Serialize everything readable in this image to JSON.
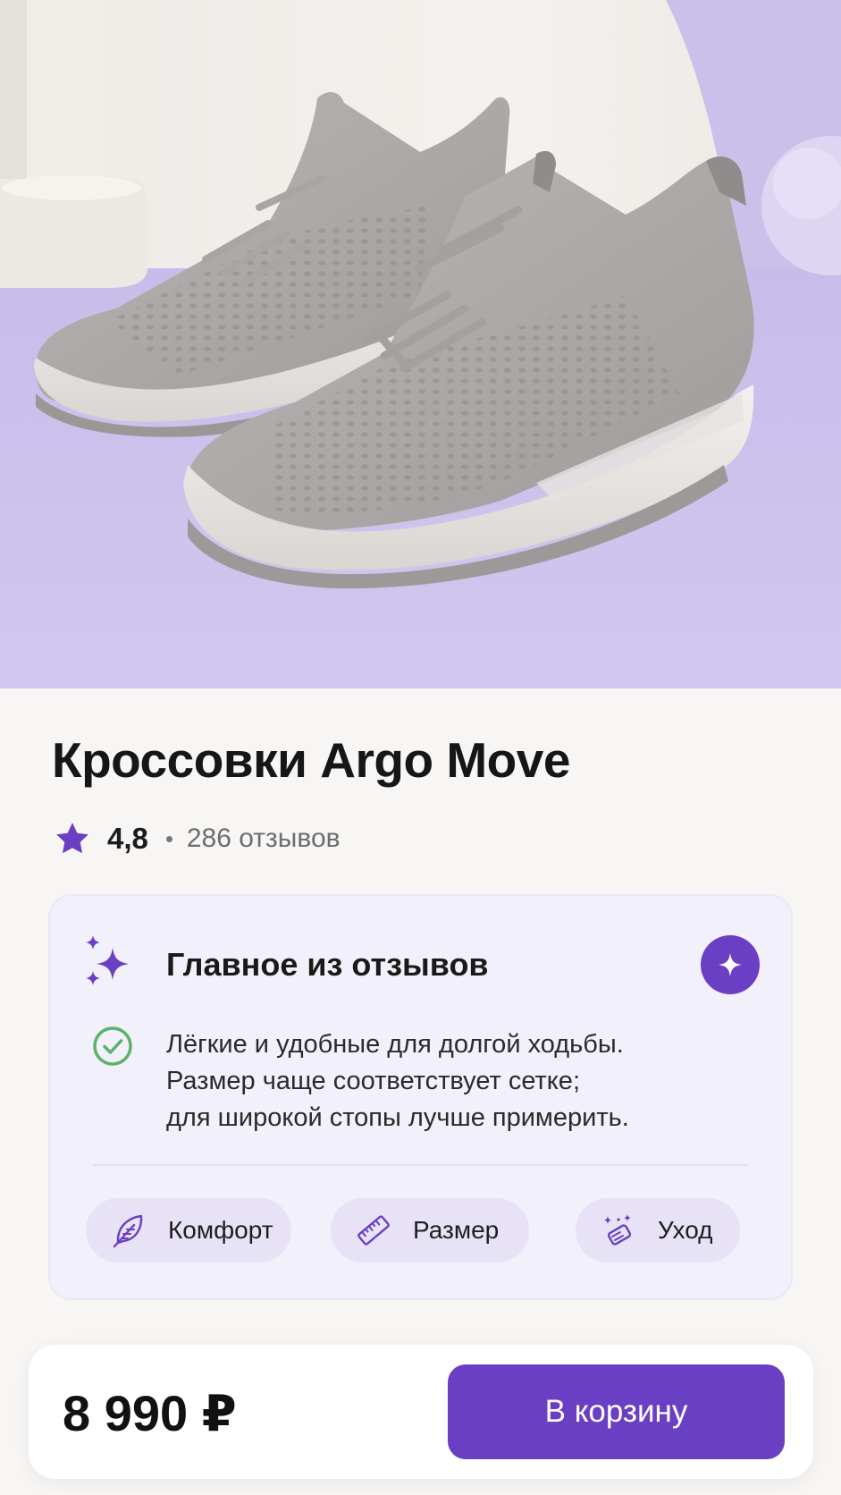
{
  "product": {
    "title": "Кроссовки Argo Move",
    "rating": "4,8",
    "reviews_count": "286 отзывов",
    "image_alt": "product-photo-sneakers"
  },
  "review_summary": {
    "title": "Главное из отзывов",
    "lines": [
      "Лёгкие и удобные для долгой ходьбы.",
      "Размер чаще соответствует сетке;",
      "для широкой стопы лучше примерить."
    ],
    "chips": [
      {
        "label": "Комфорт",
        "icon": "feather-icon"
      },
      {
        "label": "Размер",
        "icon": "ruler-icon"
      },
      {
        "label": "Уход",
        "icon": "cleaning-sparkle-icon"
      }
    ]
  },
  "purchase": {
    "price": "8 990 ₽",
    "cart_button_label": "В корзину"
  },
  "colors": {
    "accent": "#6b3fc4",
    "card_background": "#f2f0fa",
    "chip_background": "#e7e2f5",
    "check_green": "#5bb36a",
    "hero_background": "#cdc2ea"
  }
}
